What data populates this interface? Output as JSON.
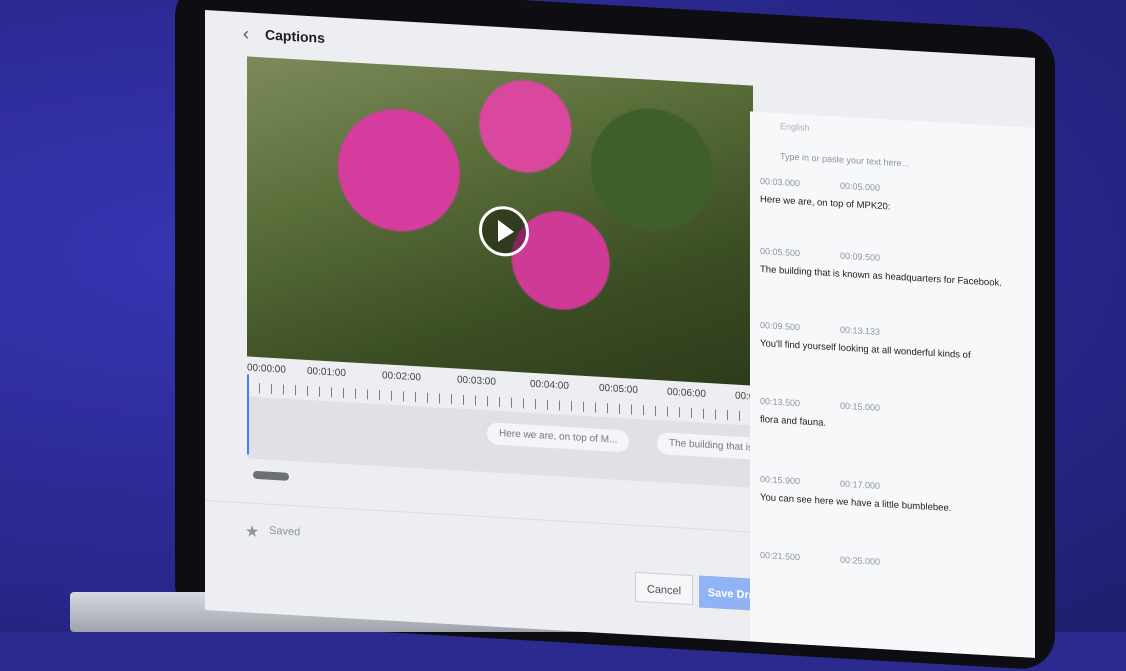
{
  "header": {
    "title": "Captions"
  },
  "timeline": {
    "ticks": [
      "00:00:00",
      "00:01:00",
      "00:02:00",
      "00:03:00",
      "00:04:00",
      "00:05:00",
      "00:06:00",
      "00:0"
    ],
    "chips": [
      "Here we are, on top of M...",
      "The building that is kr"
    ]
  },
  "footer": {
    "saved_label": "Saved",
    "cancel_label": "Cancel",
    "save_label": "Save Draft"
  },
  "panel": {
    "language": "English",
    "input_placeholder": "Type in or paste your text here...",
    "captions": [
      {
        "start": "00:03.000",
        "end": "00:05.000",
        "text": "Here we are, on top of MPK20:"
      },
      {
        "start": "00:05.500",
        "end": "00:09.500",
        "text": "The building that is known as headquarters for Facebook."
      },
      {
        "start": "00:09.500",
        "end": "00:13.133",
        "text": "You'll find yourself looking at all wonderful kinds of"
      },
      {
        "start": "00:13.500",
        "end": "00:15.000",
        "text": "flora and fauna."
      },
      {
        "start": "00:15.900",
        "end": "00:17.000",
        "text": "You can see here we have a little bumblebee."
      },
      {
        "start": "00:21.500",
        "end": "00:25.000",
        "text": ""
      }
    ]
  }
}
